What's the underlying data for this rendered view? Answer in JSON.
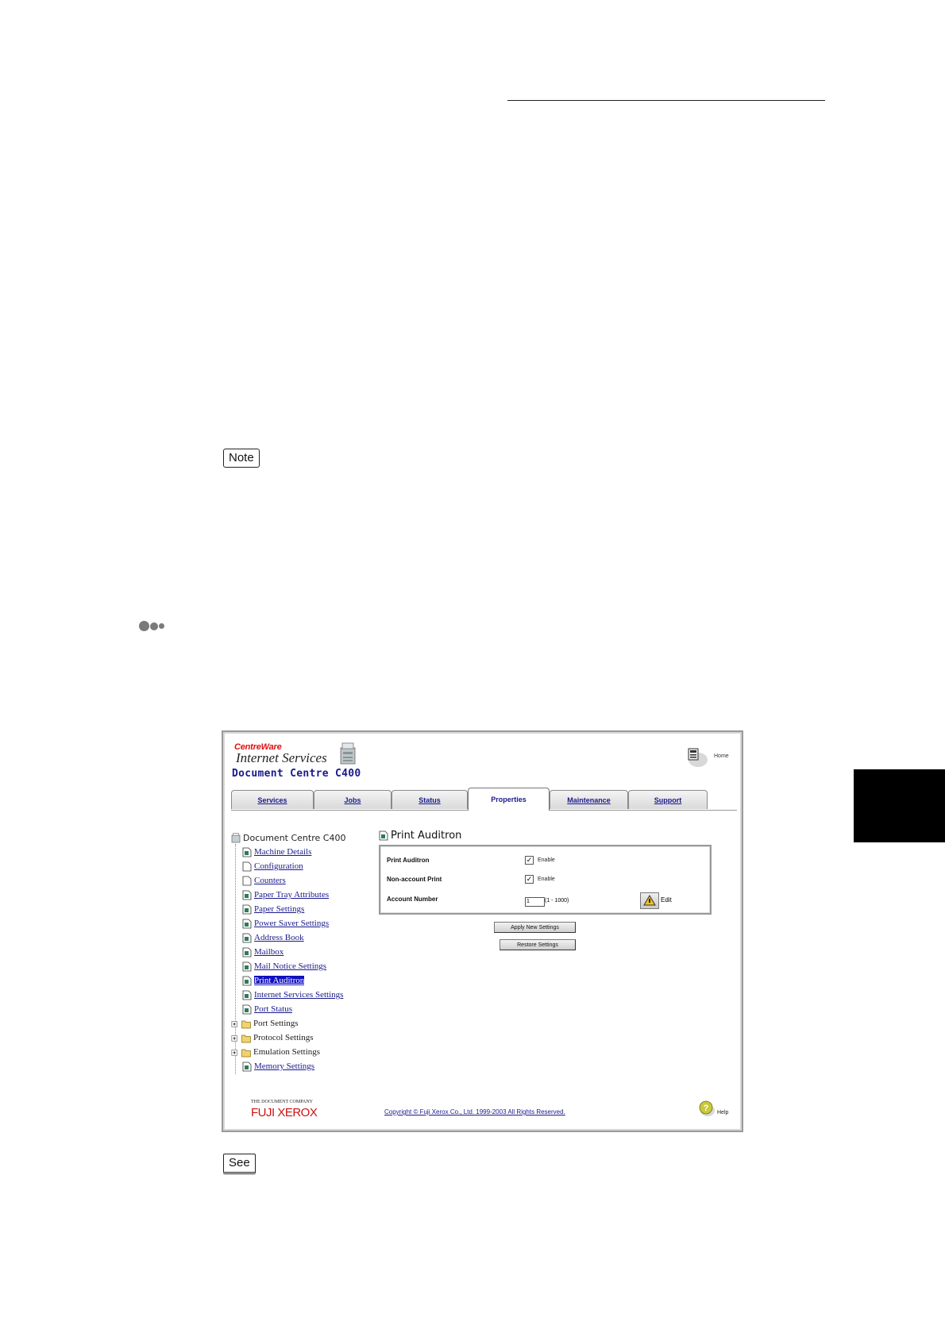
{
  "page": {
    "note_label": "Note",
    "see_label": "See"
  },
  "app": {
    "logo": "CentreWare",
    "product": "Internet Services",
    "device": "Document Centre C400",
    "home_label": "Home"
  },
  "tabs": [
    {
      "label": "Services"
    },
    {
      "label": "Jobs"
    },
    {
      "label": "Status"
    },
    {
      "label": "Properties"
    },
    {
      "label": "Maintenance"
    },
    {
      "label": "Support"
    }
  ],
  "tree": {
    "root": "Document Centre C400",
    "items": [
      {
        "label": "Machine Details"
      },
      {
        "label": "Configuration"
      },
      {
        "label": "Counters"
      },
      {
        "label": "Paper Tray Attributes"
      },
      {
        "label": "Paper Settings"
      },
      {
        "label": "Power Saver Settings"
      },
      {
        "label": "Address Book"
      },
      {
        "label": "Mailbox"
      },
      {
        "label": "Mail Notice Settings"
      },
      {
        "label": "Print Auditron"
      },
      {
        "label": "Internet Services Settings"
      },
      {
        "label": "Port Status"
      },
      {
        "label": "Port Settings"
      },
      {
        "label": "Protocol Settings"
      },
      {
        "label": "Emulation Settings"
      },
      {
        "label": "Memory Settings"
      }
    ]
  },
  "panel": {
    "title": "Print Auditron",
    "rows": [
      {
        "label": "Print Auditron",
        "checkbox_label": "Enable"
      },
      {
        "label": "Non-account Print",
        "checkbox_label": "Enable"
      }
    ],
    "account": {
      "label": "Account Number",
      "value": "1",
      "range": "(1 - 1000)",
      "edit_label": "Edit"
    },
    "apply_label": "Apply New Settings",
    "restore_label": "Restore Settings"
  },
  "footer": {
    "company_small": "THE DOCUMENT COMPANY",
    "company_logo": "FUJI XEROX",
    "copyright": "Copyright © Fuji Xerox Co., Ltd. 1999-2003 All Rights Reserved.",
    "help_label": "Help"
  }
}
